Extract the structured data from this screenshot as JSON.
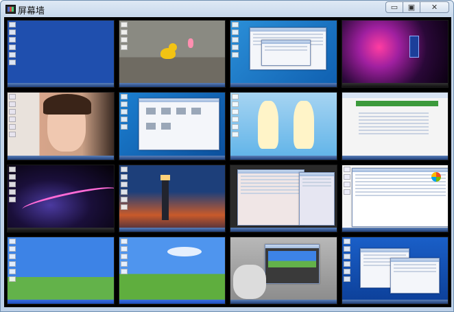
{
  "window": {
    "title": "屏幕墙"
  },
  "controls": {
    "minimize_glyph": "▭",
    "maximize_glyph": "▣",
    "close_glyph": "✕"
  },
  "tiles": [
    {
      "name": "tile-blue-desktop"
    },
    {
      "name": "tile-rubber-duck"
    },
    {
      "name": "tile-win7-dialogs"
    },
    {
      "name": "tile-galaxy-tardis"
    },
    {
      "name": "tile-girl-portrait"
    },
    {
      "name": "tile-win7-devices"
    },
    {
      "name": "tile-anime-twins"
    },
    {
      "name": "tile-web-page"
    },
    {
      "name": "tile-swirl-abstract"
    },
    {
      "name": "tile-lighthouse"
    },
    {
      "name": "tile-busy-desktop"
    },
    {
      "name": "tile-system-properties"
    },
    {
      "name": "tile-xp-bliss-1"
    },
    {
      "name": "tile-xp-bliss-2"
    },
    {
      "name": "tile-robot-windows"
    },
    {
      "name": "tile-lenovo-desktop"
    }
  ],
  "colors": {
    "title_bar": "#c9d9ec",
    "wall_background": "#000000"
  }
}
